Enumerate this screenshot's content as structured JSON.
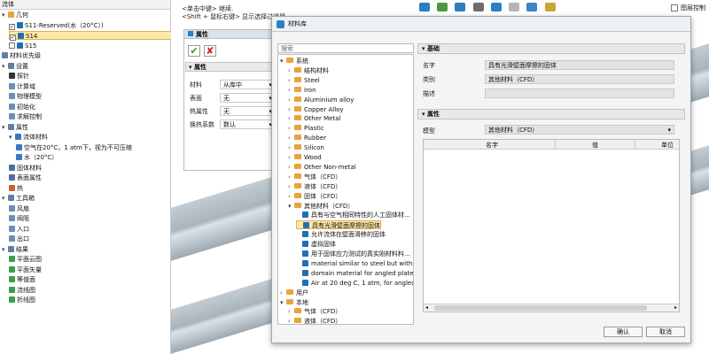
{
  "tree": {
    "header": "流体",
    "items": [
      {
        "label": "几何",
        "indent": 0,
        "icon": "folder",
        "arrow": "▾"
      },
      {
        "label": "S11-Reserved(水（20°C）)",
        "indent": 1,
        "check": true,
        "icon": "cube"
      },
      {
        "label": "S14",
        "indent": 1,
        "check": true,
        "icon": "cube",
        "selected": true
      },
      {
        "label": "S15",
        "indent": 1,
        "check": false,
        "icon": "cube"
      },
      {
        "label": "材料优先级",
        "indent": 0,
        "icon": "gear"
      },
      {
        "label": "设置",
        "indent": 0,
        "icon": "gear",
        "arrow": "▾"
      },
      {
        "label": "探针",
        "indent": 1,
        "icon": "plus"
      },
      {
        "label": "计算域",
        "indent": 1,
        "icon": "box"
      },
      {
        "label": "物理模型",
        "indent": 1,
        "icon": "box"
      },
      {
        "label": "初始化",
        "indent": 1,
        "icon": "box"
      },
      {
        "label": "求解控制",
        "indent": 1,
        "icon": "box"
      },
      {
        "label": "属性",
        "indent": 0,
        "icon": "gear",
        "arrow": "▾"
      },
      {
        "label": "流体材料",
        "indent": 1,
        "icon": "drop",
        "arrow": "▾"
      },
      {
        "label": "空气在20°C，1 atm下，视为不可压缩",
        "indent": 2,
        "icon": "drop"
      },
      {
        "label": "水（20°C）",
        "indent": 2,
        "icon": "drop"
      },
      {
        "label": "固体材料",
        "indent": 1,
        "icon": "solid"
      },
      {
        "label": "表面属性",
        "indent": 1,
        "icon": "solid"
      },
      {
        "label": "热",
        "indent": 1,
        "icon": "heat"
      },
      {
        "label": "工具箱",
        "indent": 0,
        "icon": "gear",
        "arrow": "▾"
      },
      {
        "label": "风扇",
        "indent": 1,
        "icon": "box"
      },
      {
        "label": "阀阻",
        "indent": 1,
        "icon": "box"
      },
      {
        "label": "入口",
        "indent": 1,
        "icon": "box"
      },
      {
        "label": "出口",
        "indent": 1,
        "icon": "box"
      },
      {
        "label": "结果",
        "indent": 0,
        "icon": "gear",
        "arrow": "▾"
      },
      {
        "label": "平面云图",
        "indent": 1,
        "icon": "res"
      },
      {
        "label": "平面矢量",
        "indent": 1,
        "icon": "res"
      },
      {
        "label": "等值面",
        "indent": 1,
        "icon": "res"
      },
      {
        "label": "流线图",
        "indent": 1,
        "icon": "res"
      },
      {
        "label": "折线图",
        "indent": 1,
        "icon": "res"
      }
    ]
  },
  "hint": {
    "line1": "<单击中键> 继续.",
    "line2": "<Shift + 鼠标右键> 显示选择过滤器"
  },
  "topright": {
    "label": "图层控制"
  },
  "propPanel": {
    "title": "属性",
    "section": "属性",
    "rows": [
      {
        "label": "材料",
        "value": "从库中"
      },
      {
        "label": "表面",
        "value": "无"
      },
      {
        "label": "热属性",
        "value": "无"
      },
      {
        "label": "换热系数",
        "value": "数认"
      }
    ]
  },
  "dialog": {
    "title": "材料库",
    "search": "搜索",
    "lib": [
      {
        "label": "系统",
        "indent": 0,
        "type": "folder",
        "arrow": "▾"
      },
      {
        "label": "结构材料",
        "indent": 1,
        "type": "folder",
        "arrow": "›"
      },
      {
        "label": "Steel",
        "indent": 1,
        "type": "folder",
        "arrow": "›"
      },
      {
        "label": "Iron",
        "indent": 1,
        "type": "folder",
        "arrow": "›"
      },
      {
        "label": "Aluminium alloy",
        "indent": 1,
        "type": "folder",
        "arrow": "›"
      },
      {
        "label": "Copper Alloy",
        "indent": 1,
        "type": "folder",
        "arrow": "›"
      },
      {
        "label": "Other Metal",
        "indent": 1,
        "type": "folder",
        "arrow": "›"
      },
      {
        "label": "Plastic",
        "indent": 1,
        "type": "folder",
        "arrow": "›"
      },
      {
        "label": "Rubber",
        "indent": 1,
        "type": "folder",
        "arrow": "›"
      },
      {
        "label": "Silicon",
        "indent": 1,
        "type": "folder",
        "arrow": "›"
      },
      {
        "label": "Wood",
        "indent": 1,
        "type": "folder",
        "arrow": "›"
      },
      {
        "label": "Other Non-metal",
        "indent": 1,
        "type": "folder",
        "arrow": "›"
      },
      {
        "label": "气体（CFD）",
        "indent": 1,
        "type": "folder",
        "arrow": "›"
      },
      {
        "label": "液体（CFD）",
        "indent": 1,
        "type": "folder",
        "arrow": "›"
      },
      {
        "label": "固体（CFD）",
        "indent": 1,
        "type": "folder",
        "arrow": "›"
      },
      {
        "label": "其他材料（CFD）",
        "indent": 1,
        "type": "folder",
        "arrow": "▾"
      },
      {
        "label": "具有与空气相同特性的人工固体材...",
        "indent": 2,
        "type": "cube"
      },
      {
        "label": "具有光滑壁面摩擦的固体",
        "indent": 2,
        "type": "cube",
        "selected": true
      },
      {
        "label": "允许流体在壁面滑移的固体",
        "indent": 2,
        "type": "cube"
      },
      {
        "label": "虚拟固体",
        "indent": 2,
        "type": "cube"
      },
      {
        "label": "用于固体应力测试的真实刚材料料...",
        "indent": 2,
        "type": "cube"
      },
      {
        "label": "material similar to steel but with i...",
        "indent": 2,
        "type": "cube"
      },
      {
        "label": "domain material for angled plate ...",
        "indent": 2,
        "type": "cube"
      },
      {
        "label": "Air at 20 deg C, 1 atm, for angled ...",
        "indent": 2,
        "type": "cube"
      },
      {
        "label": "用户",
        "indent": 0,
        "type": "folder",
        "arrow": "›"
      },
      {
        "label": "本地",
        "indent": 0,
        "type": "folder",
        "arrow": "▾"
      },
      {
        "label": "气体（CFD）",
        "indent": 1,
        "type": "folder",
        "arrow": "›"
      },
      {
        "label": "液体（CFD）",
        "indent": 1,
        "type": "folder",
        "arrow": "›"
      }
    ],
    "basic": {
      "header": "基础",
      "nameLabel": "名字",
      "nameValue": "具有光滑壁面摩擦的固体",
      "categoryLabel": "类别",
      "categoryValue": "其他材料（CFD）",
      "descLabel": "描述",
      "descValue": ""
    },
    "props": {
      "header": "属性",
      "modelLabel": "模型",
      "modelValue": "其他材料（CFD）",
      "columns": [
        "名字",
        "值",
        "单位"
      ]
    },
    "ok": "确认",
    "cancel": "取消"
  }
}
